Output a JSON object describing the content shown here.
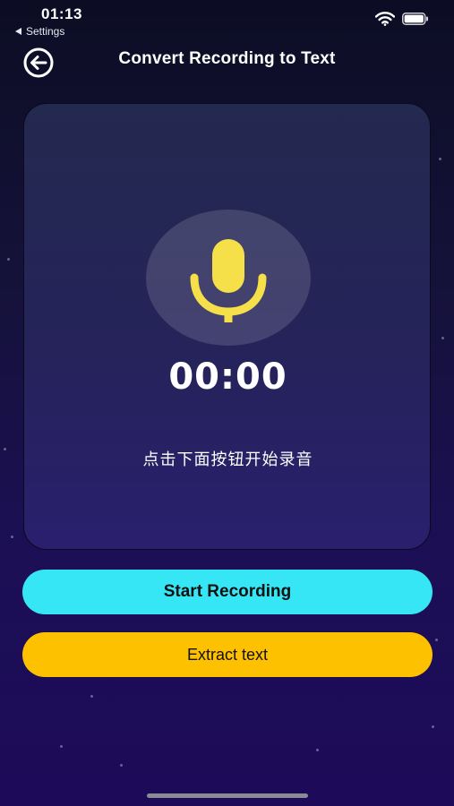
{
  "status_bar": {
    "time": "01:13",
    "back_app_label": "Settings",
    "wifi_icon": "wifi-icon",
    "battery_icon": "battery-icon"
  },
  "nav": {
    "back_icon": "back-arrow-circle-icon",
    "title": "Convert Recording to Text"
  },
  "recorder": {
    "mic_icon": "microphone-icon",
    "timer": "00:00",
    "hint": "点击下面按钮开始录音"
  },
  "actions": {
    "start_label": "Start Recording",
    "extract_label": "Extract text"
  },
  "colors": {
    "background_top": "#0c0d24",
    "background_bottom": "#1d0a58",
    "mic_yellow": "#f5e04a",
    "start_button": "#36e6f4",
    "extract_button": "#fdc100"
  }
}
